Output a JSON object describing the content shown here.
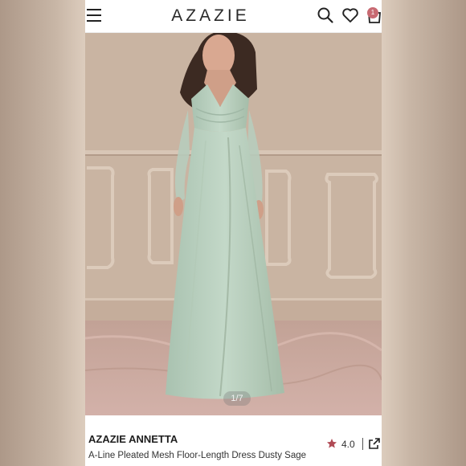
{
  "header": {
    "brand_logo": "AZAZIE",
    "cart_count": "1",
    "icons": [
      "menu-icon",
      "search-icon",
      "heart-icon",
      "shopping-bag-icon"
    ]
  },
  "gallery": {
    "counter": "1/7"
  },
  "product": {
    "brand": "AZAZIE ANNETTA",
    "title": "A-Line Pleated Mesh Floor-Length Dress Dusty Sage",
    "rating": "4.0",
    "rating_color": "#b04a55"
  },
  "colors": {
    "dress": "#b9d0bf",
    "wall": "#c8b3a1",
    "badge": "#c86a72"
  }
}
